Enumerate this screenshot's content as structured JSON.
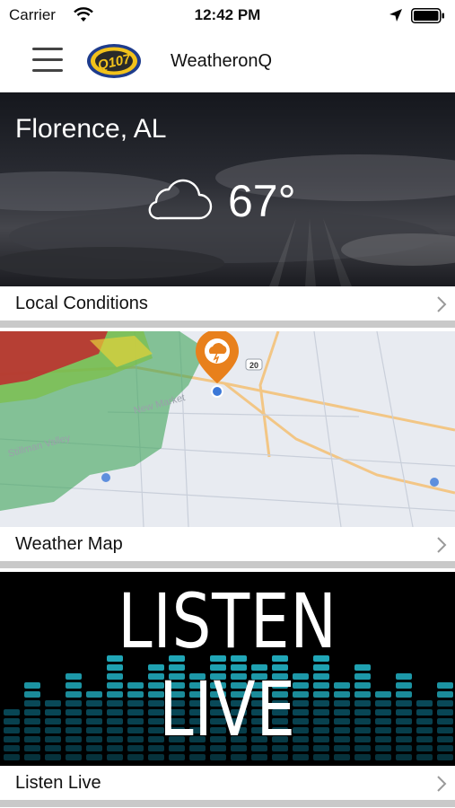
{
  "status_bar": {
    "carrier": "Carrier",
    "time": "12:42 PM"
  },
  "nav": {
    "title": "WeatheronQ",
    "logo_text": "Q107"
  },
  "cards": [
    {
      "city": "Florence, AL",
      "temperature": "67°",
      "condition_icon": "cloud-icon",
      "label": "Local Conditions"
    },
    {
      "label": "Weather Map",
      "map_texts": [
        "New Market",
        "Stillman Valley",
        "20"
      ]
    },
    {
      "headline": "LISTEN LIVE",
      "label": "Listen Live"
    }
  ],
  "colors": {
    "accent_orange": "#e8801c",
    "radar_green": "#3fa55a",
    "radar_red": "#c0282d",
    "equalizer_cyan": "#26c6da"
  }
}
